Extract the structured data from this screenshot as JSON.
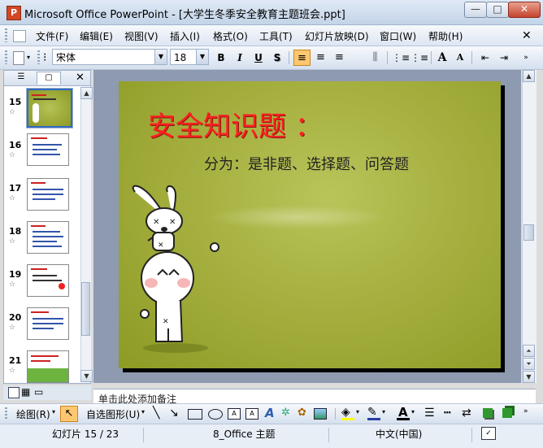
{
  "window": {
    "title": "Microsoft Office PowerPoint - [大学生冬季安全教育主题班会.ppt]",
    "app_icon": "P",
    "minimize": "—",
    "maximize": "□",
    "close": "✕"
  },
  "menu": [
    "文件(F)",
    "编辑(E)",
    "视图(V)",
    "插入(I)",
    "格式(O)",
    "工具(T)",
    "幻灯片放映(D)",
    "窗口(W)",
    "帮助(H)"
  ],
  "toolbar": {
    "font_name": "宋体",
    "font_size": "18",
    "bold": "B",
    "italic": "I",
    "underline": "U",
    "shadow": "S",
    "grow_font": "A",
    "shrink_font": "A"
  },
  "thumbnails": [
    {
      "num": "15"
    },
    {
      "num": "16"
    },
    {
      "num": "17"
    },
    {
      "num": "18"
    },
    {
      "num": "19"
    },
    {
      "num": "20"
    },
    {
      "num": "21"
    }
  ],
  "slide": {
    "title": "安全知识题 ：",
    "subtitle": "分为：是非题、选择题、问答题"
  },
  "notes": {
    "placeholder": "单击此处添加备注"
  },
  "drawbar": {
    "draw_label": "绘图(R)",
    "autoshape_label": "自选图形(U)"
  },
  "status": {
    "slide_counter": "幻灯片 15 / 23",
    "theme": "8_Office 主题",
    "language": "中文(中国)"
  },
  "colors": {
    "slide_title": "#ff2020",
    "selection": "#316ac5"
  }
}
